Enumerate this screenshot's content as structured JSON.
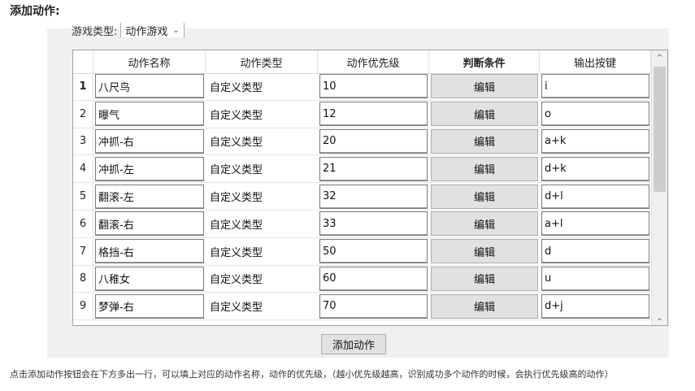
{
  "heading": "添加动作:",
  "game_type": {
    "label": "游戏类型:",
    "value": "动作游戏"
  },
  "table": {
    "headers": [
      "动作名称",
      "动作类型",
      "动作优先级",
      "判断条件",
      "输出按键"
    ],
    "rows": [
      {
        "num": "1",
        "name": "八尺鸟",
        "type": "自定义类型",
        "priority": "10",
        "condition": "编辑",
        "key": "i"
      },
      {
        "num": "2",
        "name": "曝气",
        "type": "自定义类型",
        "priority": "12",
        "condition": "编辑",
        "key": "o"
      },
      {
        "num": "3",
        "name": "冲抓-右",
        "type": "自定义类型",
        "priority": "20",
        "condition": "编辑",
        "key": "a+k"
      },
      {
        "num": "4",
        "name": "冲抓-左",
        "type": "自定义类型",
        "priority": "21",
        "condition": "编辑",
        "key": "d+k"
      },
      {
        "num": "5",
        "name": "翻滚-左",
        "type": "自定义类型",
        "priority": "32",
        "condition": "编辑",
        "key": "d+l"
      },
      {
        "num": "6",
        "name": "翻滚-右",
        "type": "自定义类型",
        "priority": "33",
        "condition": "编辑",
        "key": "a+l"
      },
      {
        "num": "7",
        "name": "格挡-右",
        "type": "自定义类型",
        "priority": "50",
        "condition": "编辑",
        "key": "d"
      },
      {
        "num": "8",
        "name": "八稚女",
        "type": "自定义类型",
        "priority": "60",
        "condition": "编辑",
        "key": "u"
      },
      {
        "num": "9",
        "name": "梦弹-右",
        "type": "自定义类型",
        "priority": "70",
        "condition": "编辑",
        "key": "d+j"
      }
    ]
  },
  "add_button": "添加动作",
  "note": "点击添加动作按钮会在下方多出一行，可以填上对应的动作名称，动作的优先级，（越小优先级越高，识别成功多个动作的时候，会执行优先级高的动作）"
}
